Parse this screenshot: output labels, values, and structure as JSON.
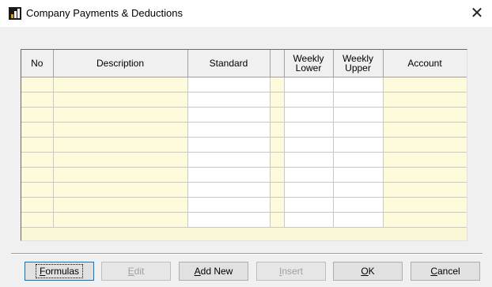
{
  "window": {
    "title": "Company Payments & Deductions",
    "close_glyph": "✕"
  },
  "grid": {
    "columns": [
      {
        "key": "no",
        "label": "No"
      },
      {
        "key": "description",
        "label": "Description"
      },
      {
        "key": "standard",
        "label": "Standard"
      },
      {
        "key": "flag",
        "label": ""
      },
      {
        "key": "weekly_lower",
        "label_line1": "Weekly",
        "label_line2": "Lower"
      },
      {
        "key": "weekly_upper",
        "label_line1": "Weekly",
        "label_line2": "Upper"
      },
      {
        "key": "account",
        "label": "Account"
      }
    ],
    "row_count": 10
  },
  "buttons": {
    "formulas": {
      "label": "Formulas",
      "mnemonic": "F",
      "rest": "ormulas",
      "enabled": true
    },
    "edit": {
      "label": "Edit",
      "mnemonic": "E",
      "rest": "dit",
      "enabled": false
    },
    "add_new": {
      "label": "Add New",
      "mnemonic": "A",
      "rest": "dd New",
      "enabled": true
    },
    "insert": {
      "label": "Insert",
      "mnemonic": "I",
      "rest": "nsert",
      "enabled": false
    },
    "ok": {
      "label": "OK",
      "mnemonic": "O",
      "rest": "K",
      "enabled": true
    },
    "cancel": {
      "label": "Cancel",
      "mnemonic": "C",
      "rest": "ancel",
      "enabled": true
    }
  },
  "colors": {
    "grid_yellow": "#fdfbdc",
    "grid_white": "#ffffff",
    "focus_blue": "#0078d7"
  }
}
